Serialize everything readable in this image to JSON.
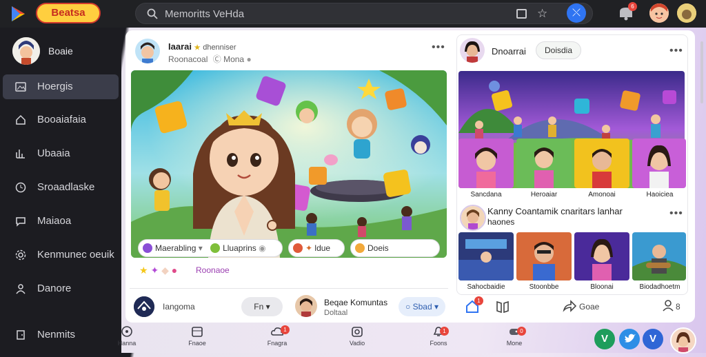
{
  "topbar": {
    "brand": "Beatsa",
    "search_placeholder": "Memoritts VeHda",
    "notif_count": "6"
  },
  "sidebar": {
    "profile_name": "Boaie",
    "items": [
      {
        "label": "Hoergis",
        "icon": "image-icon",
        "active": true
      },
      {
        "label": "Booaiafaia",
        "icon": "home-icon",
        "active": false
      },
      {
        "label": "Ubaaia",
        "icon": "chart-icon",
        "active": false
      },
      {
        "label": "Sroaadlaske",
        "icon": "clock-icon",
        "active": false
      },
      {
        "label": "Maiaoa",
        "icon": "chat-icon",
        "active": false
      },
      {
        "label": "Kenmunec oeuik",
        "icon": "gear-icon",
        "active": false
      },
      {
        "label": "Danore",
        "icon": "people-icon",
        "active": false
      },
      {
        "label": "Nenmits",
        "icon": "door-icon",
        "active": false
      }
    ]
  },
  "main_post": {
    "author": "Iaarai",
    "author_tag": "dhenniser",
    "subtitle": "Roonacoal",
    "subtitle_tag": "Mona",
    "chips": [
      {
        "label": "Maerabling",
        "color": "#8a4fd6"
      },
      {
        "label": "Lluaprins",
        "color": "#7fbf3a"
      },
      {
        "label": "ldue",
        "color": "#e05a3a"
      },
      {
        "label": "Doeis",
        "color": "#f2a93b"
      }
    ],
    "reaction_label": "Roonaoe"
  },
  "bottom_bar": {
    "left_label": "Iangoma",
    "fn_label": "Fn",
    "community_title": "Beqae Komuntas",
    "community_sub": "Doltaal",
    "sd_label": "Sbad",
    "like_count": "1",
    "share_label": "Goae",
    "people_label": "8"
  },
  "right_post": {
    "author": "Dnoarrai",
    "follow_label": "Doisdia",
    "thumbs_top": [
      "Sancdana",
      "Heroaiar",
      "Amonoai",
      "Haoiciea"
    ],
    "community_title": "Kanny Coantamik cnaritars lanhar",
    "community_sub": "haones",
    "thumbs_bottom": [
      "Sahocbaidie",
      "Stoonbbe",
      "Bloonai",
      "Biodadhoetm"
    ]
  },
  "dock": {
    "items": [
      {
        "label": "Hanna",
        "icon": "compass-icon",
        "badge": ""
      },
      {
        "label": "Fnaoe",
        "icon": "calendar-icon",
        "badge": ""
      },
      {
        "label": "Fnagra",
        "icon": "cloud-icon",
        "badge": "1"
      },
      {
        "label": "Vadio",
        "icon": "camera-icon",
        "badge": ""
      },
      {
        "label": "Foons",
        "icon": "bell-icon",
        "badge": "1"
      },
      {
        "label": "Mone",
        "icon": "gamepad-icon",
        "badge": "0"
      }
    ],
    "social": [
      {
        "label": "V",
        "color": "#1e9d5c"
      },
      {
        "label": "t",
        "color": "#2d8ee6"
      },
      {
        "label": "V",
        "color": "#2f66d6"
      }
    ]
  },
  "colors": {
    "accent": "#2f74f2",
    "sidebar_bg": "#1c1c21",
    "active_bg": "#3b3d4a"
  }
}
